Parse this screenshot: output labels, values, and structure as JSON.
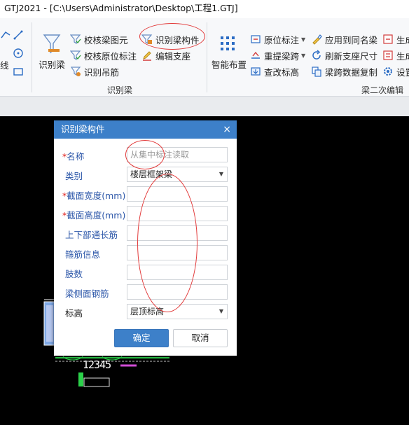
{
  "window": {
    "title": "GTJ2021 - [C:\\Users\\Administrator\\Desktop\\工程1.GTJ]"
  },
  "ribbon": {
    "left_partial_label": "线",
    "identify_beam_big": "识别梁",
    "check_beam_element": "校核梁图元",
    "check_original_annotation": "校核原位标注",
    "identify_hanger": "识别吊筋",
    "identify_beam_component": "识别梁构件",
    "edit_support": "编辑支座",
    "group_identify_beam": "识别梁",
    "smart_layout": "智能布置",
    "original_annotation": "原位标注",
    "re_extract_span": "重提梁跨",
    "query_level": "查改标高",
    "apply_same_name": "应用到同名梁",
    "refresh_support_size": "刷新支座尺寸",
    "span_data_copy": "梁跨数据复制",
    "generate_1": "生成",
    "generate_2": "生成",
    "settings": "设置",
    "group_beam_secondary_edit": "梁二次编辑"
  },
  "dialog": {
    "title": "识别梁构件",
    "close": "×",
    "required_mark": "*",
    "fields": [
      {
        "label": "名称",
        "required": true,
        "placeholder": "从集中标注读取",
        "value": ""
      },
      {
        "label": "类别",
        "required": false,
        "value": "楼层框架梁"
      },
      {
        "label": "截面宽度(mm)",
        "required": true,
        "value": ""
      },
      {
        "label": "截面高度(mm)",
        "required": true,
        "value": ""
      },
      {
        "label": "上下部通长筋",
        "required": false,
        "value": ""
      },
      {
        "label": "箍筋信息",
        "required": false,
        "value": ""
      },
      {
        "label": "肢数",
        "required": false,
        "value": ""
      },
      {
        "label": "梁侧面钢筋",
        "required": false,
        "value": ""
      },
      {
        "label": "标高",
        "required": false,
        "value": "层顶标高"
      }
    ],
    "ok": "确定",
    "cancel": "取消"
  },
  "canvas": {
    "drawing_text": "12345"
  },
  "colors": {
    "dialog_title": "#3d80c9",
    "label_blue": "#2a55a8",
    "required": "#e0201c",
    "annotation": "#e23a3a"
  }
}
